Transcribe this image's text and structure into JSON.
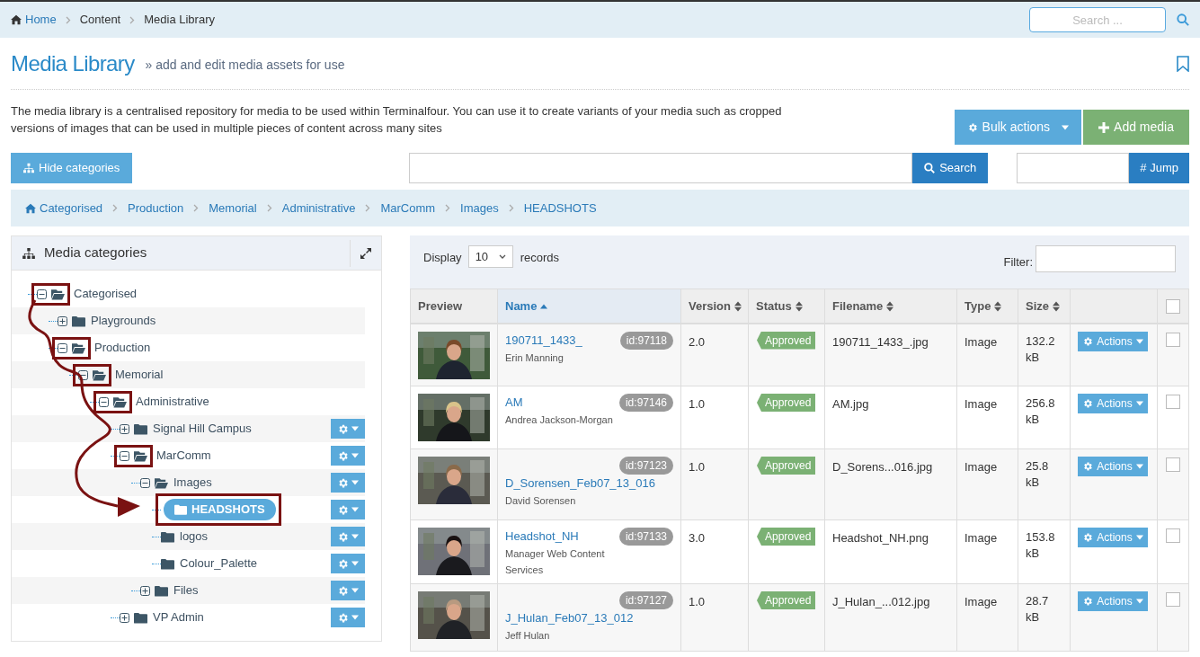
{
  "top_breadcrumb": [
    {
      "label": "Home",
      "kind": "link"
    },
    {
      "label": "Content",
      "kind": "text"
    },
    {
      "label": "Media Library",
      "kind": "text"
    }
  ],
  "top_search": {
    "placeholder": "Search ..."
  },
  "page": {
    "title": "Media Library",
    "subtitle": "» add and edit media assets for use",
    "description": "The media library is a centralised repository for media to be used within Terminalfour. You can use it to create variants of your media such as cropped versions of images that can be used in multiple pieces of content across many sites"
  },
  "buttons": {
    "bulk_actions": "Bulk actions",
    "add_media": "Add media",
    "hide_categories": "Hide categories",
    "search": "Search",
    "jump": "# Jump"
  },
  "category_path": [
    "Categorised",
    "Production",
    "Memorial",
    "Administrative",
    "MarComm",
    "Images",
    "HEADSHOTS"
  ],
  "categories_panel": {
    "title": "Media categories"
  },
  "tree": [
    {
      "label": "Categorised",
      "expanded": true,
      "selected": false,
      "highlighted": true,
      "menu": false,
      "children": [
        {
          "label": "Playgrounds",
          "expanded": false,
          "selected": false,
          "highlighted": false,
          "menu": false
        },
        {
          "label": "Production",
          "expanded": true,
          "selected": false,
          "highlighted": true,
          "menu": false,
          "children": [
            {
              "label": "Memorial",
              "expanded": true,
              "selected": false,
              "highlighted": true,
              "menu": false,
              "children": [
                {
                  "label": "Administrative",
                  "expanded": true,
                  "selected": false,
                  "highlighted": true,
                  "menu": false,
                  "children": [
                    {
                      "label": "Signal Hill Campus",
                      "expanded": false,
                      "selected": false,
                      "highlighted": false,
                      "menu": true
                    },
                    {
                      "label": "MarComm",
                      "expanded": true,
                      "selected": false,
                      "highlighted": true,
                      "menu": true,
                      "children": [
                        {
                          "label": "Images",
                          "expanded": true,
                          "selected": false,
                          "highlighted": false,
                          "menu": true,
                          "children": [
                            {
                              "label": "HEADSHOTS",
                              "selected": true,
                              "highlighted": true,
                              "menu": true
                            },
                            {
                              "label": "logos",
                              "selected": false,
                              "highlighted": false,
                              "menu": true
                            },
                            {
                              "label": "Colour_Palette",
                              "selected": false,
                              "highlighted": false,
                              "menu": true
                            }
                          ]
                        },
                        {
                          "label": "Files",
                          "expanded": false,
                          "selected": false,
                          "highlighted": false,
                          "menu": true
                        }
                      ]
                    },
                    {
                      "label": "VP Admin",
                      "expanded": false,
                      "selected": false,
                      "highlighted": false,
                      "menu": true
                    }
                  ]
                }
              ]
            }
          ]
        }
      ]
    }
  ],
  "table_controls": {
    "display_label": "Display",
    "page_size": "10",
    "records_label": "records",
    "filter_label": "Filter:"
  },
  "table": {
    "columns": [
      {
        "label": "Preview",
        "sortable": false,
        "sorted": false
      },
      {
        "label": "Name",
        "sortable": true,
        "sorted": true
      },
      {
        "label": "Version",
        "sortable": true,
        "sorted": false
      },
      {
        "label": "Status",
        "sortable": true,
        "sorted": false
      },
      {
        "label": "Filename",
        "sortable": true,
        "sorted": false
      },
      {
        "label": "Type",
        "sortable": true,
        "sorted": false
      },
      {
        "label": "Size",
        "sortable": true,
        "sorted": false
      }
    ],
    "select_all_checked": false,
    "rows": [
      {
        "name": "190711_1433_",
        "description": "Erin Manning",
        "id": "id:97118",
        "version": "2.0",
        "status": "Approved",
        "filename": "190711_1433_.jpg",
        "type": "Image",
        "size": "132.2 kB",
        "actions": "Actions",
        "checked": false
      },
      {
        "name": "AM",
        "description": "Andrea Jackson-Morgan",
        "id": "id:97146",
        "version": "1.0",
        "status": "Approved",
        "filename": "AM.jpg",
        "type": "Image",
        "size": "256.8 kB",
        "actions": "Actions",
        "checked": false
      },
      {
        "name": "D_Sorensen_Feb07_13_016",
        "description": "David Sorensen",
        "id": "id:97123",
        "version": "1.0",
        "status": "Approved",
        "filename": "D_Sorens...016.jpg",
        "type": "Image",
        "size": "25.8 kB",
        "actions": "Actions",
        "checked": false
      },
      {
        "name": "Headshot_NH",
        "description": "Manager Web Content Services",
        "id": "id:97133",
        "version": "3.0",
        "status": "Approved",
        "filename": "Headshot_NH.png",
        "type": "Image",
        "size": "153.8 kB",
        "actions": "Actions",
        "checked": false
      },
      {
        "name": "J_Hulan_Feb07_13_012",
        "description": "Jeff Hulan",
        "id": "id:97127",
        "version": "1.0",
        "status": "Approved",
        "filename": "J_Hulan_...012.jpg",
        "type": "Image",
        "size": "28.7 kB",
        "actions": "Actions",
        "checked": false
      }
    ]
  }
}
